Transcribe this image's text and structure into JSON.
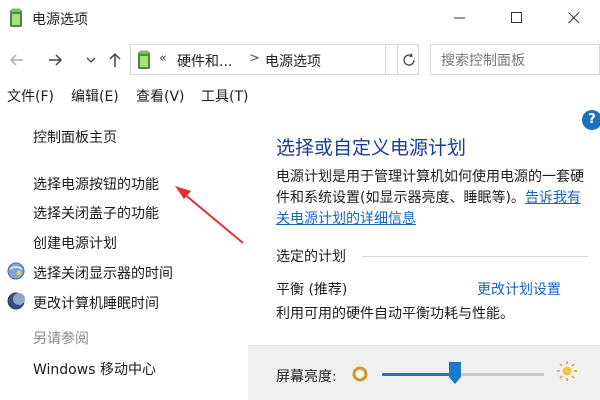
{
  "window": {
    "title": "电源选项"
  },
  "address": {
    "chevrons": "«",
    "crumbs": [
      "硬件和...",
      "电源选项"
    ],
    "separator": ">"
  },
  "search": {
    "placeholder": "搜索控制面板"
  },
  "menu": [
    "文件(F)",
    "编辑(E)",
    "查看(V)",
    "工具(T)"
  ],
  "left_nav": {
    "home": "控制面板主页",
    "links": [
      "选择电源按钮的功能",
      "选择关闭盖子的功能",
      "创建电源计划",
      "选择关闭显示器的时间",
      "更改计算机睡眠时间"
    ],
    "see_also": "另请参阅",
    "mobility": "Windows 移动中心"
  },
  "main": {
    "title": "选择或自定义电源计划",
    "desc_text": "电源计划是用于管理计算机如何使用电源的一套硬件和系统设置(如显示器亮度、睡眠等)。",
    "desc_link": "告诉我有关电源计划的详细信息",
    "section": "选定的计划",
    "plan_name": "平衡 (推荐)",
    "plan_link": "更改计划设置",
    "plan_desc": "利用可用的硬件自动平衡功耗与性能。"
  },
  "brightness": {
    "label": "屏幕亮度:",
    "level": 0.45
  },
  "colors": {
    "link": "#1665c0",
    "title": "#1c3c8c",
    "annotation_arrow": "#e03030",
    "slider": "#1979ca"
  },
  "icons": [
    "power-options-icon",
    "minimize-icon",
    "maximize-icon",
    "close-icon",
    "back-arrow-icon",
    "forward-arrow-icon",
    "chevron-down-icon",
    "up-arrow-icon",
    "refresh-icon",
    "help-icon",
    "monitor-icon",
    "moon-icon",
    "brightness-dim-icon",
    "brightness-bright-icon"
  ]
}
